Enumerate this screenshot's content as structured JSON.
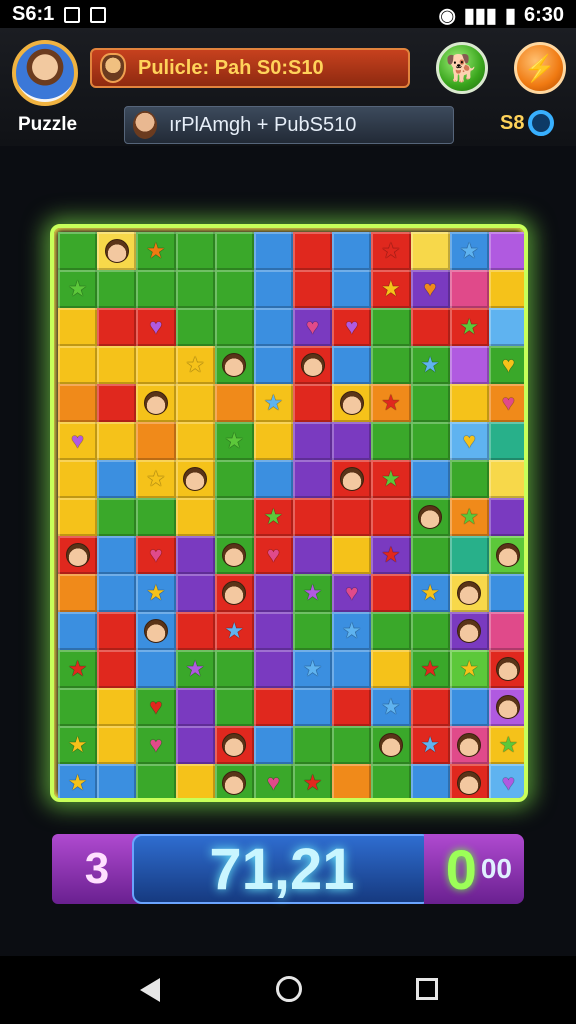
{
  "status_bar": {
    "left_text": "S6:1",
    "time": "6:30"
  },
  "header": {
    "avatar_label": "Puzzle",
    "title": "Pulicle: Pah S0:S10",
    "subtitle": "ırPlAmgh + PubS510",
    "coins": "S8"
  },
  "colors": {
    "board_glow": "#c8ff5a",
    "accent_orange": "#f07a12",
    "accent_green": "#39a51c"
  },
  "board": {
    "palette": {
      "G": "#3aa82a",
      "g": "#5cc83a",
      "Y": "#f5c21a",
      "y": "#f7d84a",
      "R": "#e0281e",
      "O": "#f08a1a",
      "B": "#3b8fe0",
      "b": "#5fb3f0",
      "P": "#7a3ac0",
      "p": "#b05ae0",
      "T": "#28b08a",
      "K": "#e04a8a"
    },
    "rows": [
      "GyGGGBRBR",
      "GGGGGBRBR",
      "YRRGGBPRGR",
      "YYYYGBRBGG",
      "ORYYOYRYOG",
      "YYOYGYPPGG",
      "YBYYGBPRRB",
      "YGGYGRRRRG",
      "RBRPGRPYPG",
      "OBBPRPGPRB",
      "BRBRRPGBGG",
      "GRBGGPBBYG",
      "GYGPGRBRBR",
      "GYGPRBGGGR",
      "BBGYGGGOGB"
    ],
    "icons": [
      {
        "r": 0,
        "c": 1,
        "type": "face"
      },
      {
        "r": 0,
        "c": 2,
        "type": "star",
        "color": "#f07a12"
      },
      {
        "r": 0,
        "c": 8,
        "type": "star",
        "color": "#e0281e"
      },
      {
        "r": 0,
        "c": 10,
        "type": "star",
        "color": "#5fb3f0"
      },
      {
        "r": 1,
        "c": 0,
        "type": "star",
        "color": "#5cc83a"
      },
      {
        "r": 1,
        "c": 8,
        "type": "star",
        "color": "#f5c21a"
      },
      {
        "r": 1,
        "c": 9,
        "type": "heart",
        "color": "#f08a1a"
      },
      {
        "r": 2,
        "c": 2,
        "type": "heart",
        "color": "#b05ae0"
      },
      {
        "r": 2,
        "c": 6,
        "type": "heart",
        "color": "#e04a8a"
      },
      {
        "r": 2,
        "c": 7,
        "type": "heart",
        "color": "#b05ae0"
      },
      {
        "r": 2,
        "c": 10,
        "type": "star",
        "color": "#5cc83a"
      },
      {
        "r": 3,
        "c": 3,
        "type": "star",
        "color": "#f5c21a"
      },
      {
        "r": 3,
        "c": 4,
        "type": "face"
      },
      {
        "r": 3,
        "c": 6,
        "type": "face"
      },
      {
        "r": 3,
        "c": 9,
        "type": "star",
        "color": "#5fb3f0"
      },
      {
        "r": 3,
        "c": 11,
        "type": "heart",
        "color": "#f5c21a"
      },
      {
        "r": 4,
        "c": 2,
        "type": "face"
      },
      {
        "r": 4,
        "c": 5,
        "type": "star",
        "color": "#5fb3f0"
      },
      {
        "r": 4,
        "c": 7,
        "type": "face"
      },
      {
        "r": 4,
        "c": 8,
        "type": "star",
        "color": "#e0281e"
      },
      {
        "r": 4,
        "c": 11,
        "type": "heart",
        "color": "#e04a8a"
      },
      {
        "r": 5,
        "c": 0,
        "type": "heart",
        "color": "#b05ae0"
      },
      {
        "r": 5,
        "c": 4,
        "type": "star",
        "color": "#5cc83a"
      },
      {
        "r": 5,
        "c": 10,
        "type": "heart",
        "color": "#f5c21a"
      },
      {
        "r": 6,
        "c": 2,
        "type": "star",
        "color": "#f5c21a"
      },
      {
        "r": 6,
        "c": 3,
        "type": "face"
      },
      {
        "r": 6,
        "c": 7,
        "type": "face"
      },
      {
        "r": 6,
        "c": 8,
        "type": "star",
        "color": "#5cc83a"
      },
      {
        "r": 7,
        "c": 5,
        "type": "star",
        "color": "#5cc83a"
      },
      {
        "r": 7,
        "c": 9,
        "type": "face"
      },
      {
        "r": 7,
        "c": 10,
        "type": "star",
        "color": "#5cc83a"
      },
      {
        "r": 8,
        "c": 0,
        "type": "face"
      },
      {
        "r": 8,
        "c": 2,
        "type": "heart",
        "color": "#e04a8a"
      },
      {
        "r": 8,
        "c": 4,
        "type": "face"
      },
      {
        "r": 8,
        "c": 5,
        "type": "heart",
        "color": "#e04a8a"
      },
      {
        "r": 8,
        "c": 8,
        "type": "star",
        "color": "#e0281e"
      },
      {
        "r": 8,
        "c": 11,
        "type": "face"
      },
      {
        "r": 9,
        "c": 2,
        "type": "star",
        "color": "#f5c21a"
      },
      {
        "r": 9,
        "c": 4,
        "type": "face"
      },
      {
        "r": 9,
        "c": 6,
        "type": "star",
        "color": "#b05ae0"
      },
      {
        "r": 9,
        "c": 7,
        "type": "heart",
        "color": "#e04a8a"
      },
      {
        "r": 9,
        "c": 9,
        "type": "star",
        "color": "#f5c21a"
      },
      {
        "r": 9,
        "c": 10,
        "type": "face"
      },
      {
        "r": 10,
        "c": 2,
        "type": "face"
      },
      {
        "r": 10,
        "c": 4,
        "type": "star",
        "color": "#5fb3f0"
      },
      {
        "r": 10,
        "c": 7,
        "type": "star",
        "color": "#5fb3f0"
      },
      {
        "r": 10,
        "c": 10,
        "type": "face"
      },
      {
        "r": 11,
        "c": 0,
        "type": "star",
        "color": "#e0281e"
      },
      {
        "r": 11,
        "c": 3,
        "type": "star",
        "color": "#b05ae0"
      },
      {
        "r": 11,
        "c": 6,
        "type": "star",
        "color": "#5fb3f0"
      },
      {
        "r": 11,
        "c": 9,
        "type": "star",
        "color": "#e0281e"
      },
      {
        "r": 11,
        "c": 10,
        "type": "star",
        "color": "#f5c21a"
      },
      {
        "r": 11,
        "c": 11,
        "type": "face"
      },
      {
        "r": 12,
        "c": 2,
        "type": "heart",
        "color": "#e0281e"
      },
      {
        "r": 12,
        "c": 8,
        "type": "star",
        "color": "#5fb3f0"
      },
      {
        "r": 12,
        "c": 11,
        "type": "face"
      },
      {
        "r": 13,
        "c": 0,
        "type": "star",
        "color": "#f5c21a"
      },
      {
        "r": 13,
        "c": 2,
        "type": "heart",
        "color": "#e04a8a"
      },
      {
        "r": 13,
        "c": 4,
        "type": "face"
      },
      {
        "r": 13,
        "c": 8,
        "type": "face"
      },
      {
        "r": 13,
        "c": 9,
        "type": "star",
        "color": "#5fb3f0"
      },
      {
        "r": 13,
        "c": 10,
        "type": "face"
      },
      {
        "r": 13,
        "c": 11,
        "type": "star",
        "color": "#5cc83a"
      },
      {
        "r": 14,
        "c": 0,
        "type": "star",
        "color": "#f5c21a"
      },
      {
        "r": 14,
        "c": 4,
        "type": "face"
      },
      {
        "r": 14,
        "c": 5,
        "type": "heart",
        "color": "#e04a8a"
      },
      {
        "r": 14,
        "c": 6,
        "type": "star",
        "color": "#e0281e"
      },
      {
        "r": 14,
        "c": 10,
        "type": "face"
      },
      {
        "r": 14,
        "c": 11,
        "type": "heart",
        "color": "#b05ae0"
      }
    ]
  },
  "score": {
    "left": "3",
    "main": "71,21",
    "right_big": "0",
    "right_small": "00"
  }
}
